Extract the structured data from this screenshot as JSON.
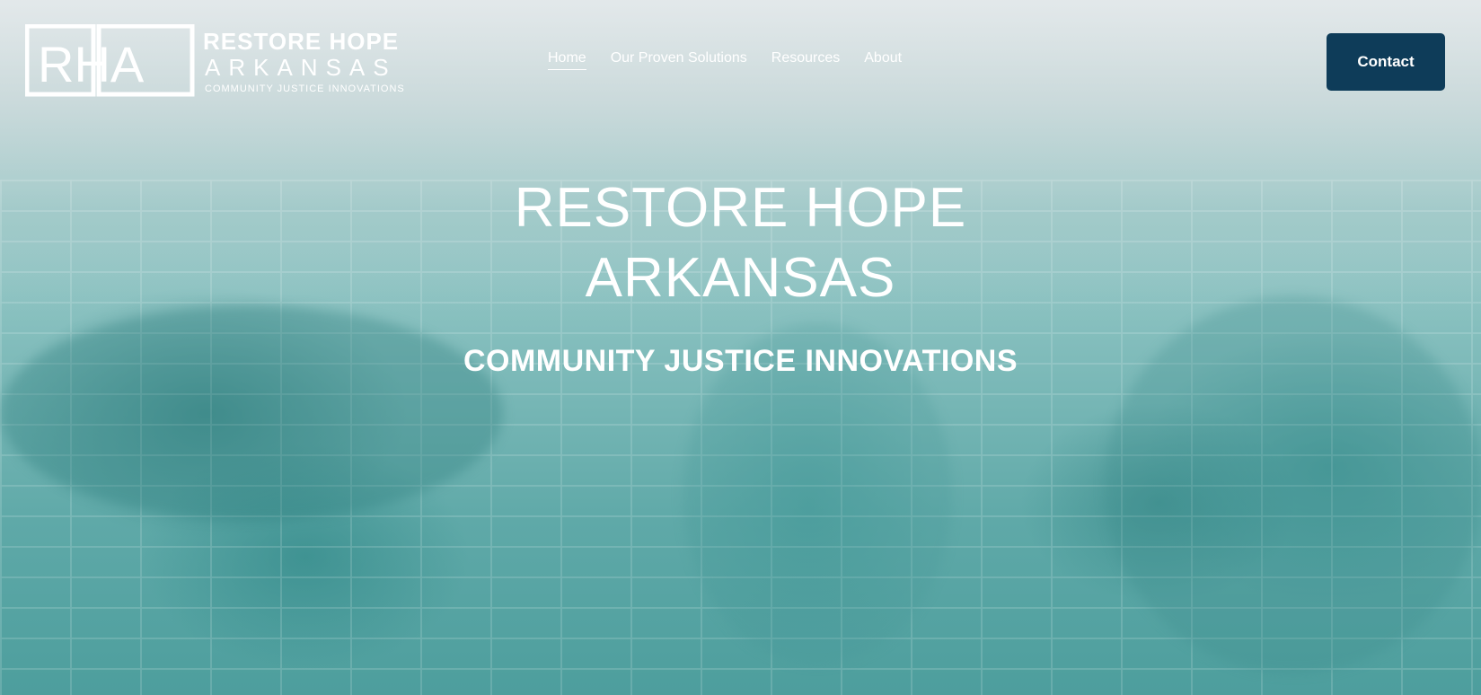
{
  "header": {
    "logo": {
      "mark": "RHA",
      "line1": "RESTORE HOPE",
      "line2": "ARKANSAS",
      "line3": "COMMUNITY JUSTICE INNOVATIONS"
    },
    "nav": [
      {
        "label": "Home",
        "active": true
      },
      {
        "label": "Our Proven Solutions",
        "active": false
      },
      {
        "label": "Resources",
        "active": false
      },
      {
        "label": "About",
        "active": false
      }
    ],
    "contact_label": "Contact"
  },
  "hero": {
    "title_line1": "RESTORE HOPE",
    "title_line2": "ARKANSAS",
    "subtitle": "COMMUNITY JUSTICE INNOVATIONS"
  },
  "colors": {
    "contact_button": "#0e3c59",
    "hero_tint": "#5fa9a8",
    "text": "#ffffff"
  }
}
